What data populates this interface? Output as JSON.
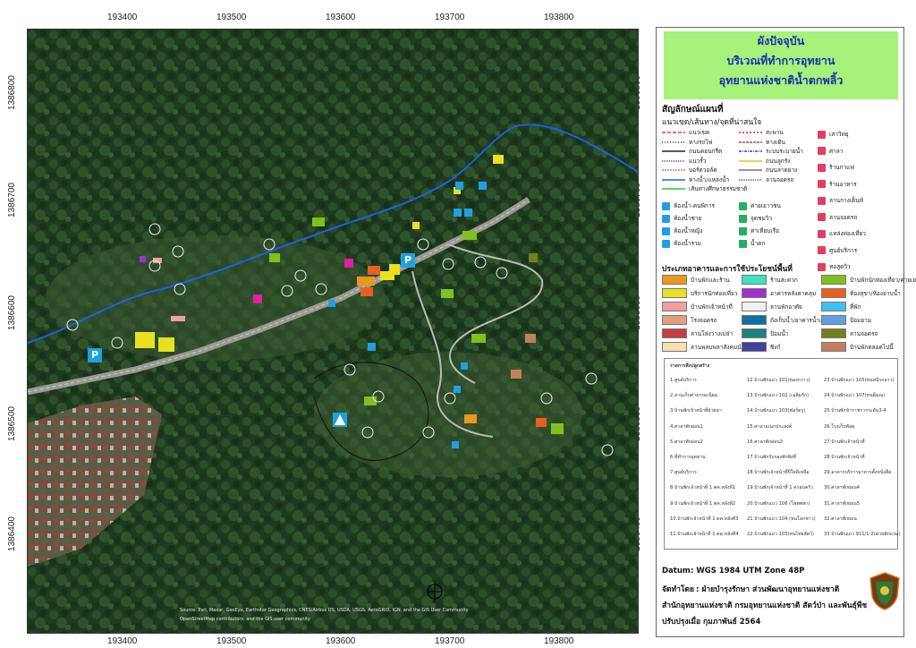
{
  "map": {
    "x_ticks": [
      "193400",
      "193500",
      "193600",
      "193700",
      "193800"
    ],
    "y_ticks": [
      "1386800",
      "1386700",
      "1386600",
      "1386500",
      "1386400"
    ],
    "parking_label": "P",
    "attribution_1": "Source: Esri, Maxar, GeoEye, Earthstar Geographics, CNES/Airbus DS, USDA, USGS, AeroGRID, IGN, and the GIS User Community",
    "attribution_2": "OpenStreetMap contributors, and the GIS user community"
  },
  "panel": {
    "title_lines": [
      "ผังปัจจุบัน",
      "บริเวณที่ทำการอุทยาน",
      "อุทยานแห่งชาติน้ำตกพลิ้ว"
    ],
    "legend_title": "สัญลักษณ์แผนที่",
    "legend_subtitle": "แนวเขต/เส้นทาง/จุดที่น่าสนใจ",
    "lines": [
      {
        "label": "แนวเขต",
        "color": "#e04040",
        "dash": "4,2"
      },
      {
        "label": "สะพาน",
        "color": "#c03030",
        "dash": "2,2"
      },
      {
        "label": "ทางรถไฟ",
        "color": "#333333",
        "dash": "1,2"
      },
      {
        "label": "ทางเดิน",
        "color": "#c04040",
        "dash": "3,1"
      },
      {
        "label": "ถนนคอนกรีต",
        "color": "#222222",
        "dash": ""
      },
      {
        "label": "ระบบระบายน้ำ",
        "color": "#3040c0",
        "dash": "3,1,1,1"
      },
      {
        "label": "แนวรั้ว",
        "color": "#555555",
        "dash": "1,1"
      },
      {
        "label": "ถนนลูกรัง",
        "color": "#e8c020",
        "dash": ""
      },
      {
        "label": "บอร์ดวอล์ค",
        "color": "#c08060",
        "dash": "2,1"
      },
      {
        "label": "ถนนลาดยาง",
        "color": "#777777",
        "dash": ""
      },
      {
        "label": "ทางน้ำ/แหล่งน้ำ",
        "color": "#2060e0",
        "dash": ""
      },
      {
        "label": "ลานจอดรถ",
        "color": "#555555",
        "dash": "1,1"
      },
      {
        "label": "เส้นทางศึกษาธรรมชาติ",
        "color": "#30c030",
        "dash": ""
      }
    ],
    "poi_col1": [
      "ห้องน้ำ-คนพิการ",
      "ห้องน้ำชาย",
      "ห้องน้ำหญิง",
      "ห้องน้ำรวม"
    ],
    "poi_col2": [
      "ค่ายเยาวชน",
      "จุดชมวิว",
      "ท่าเทียบเรือ",
      "น้ำตก"
    ],
    "poi_col3": [
      "เสาวิทยุ",
      "ศาลา",
      "ร้านกาแฟ",
      "ร้านอาหาร",
      "ลานกางเต็นท์",
      "ลานจอดรถ",
      "แหล่งท่องเที่ยว",
      "ศูนย์บริการ",
      "หอสูดวิว"
    ],
    "building_title": "ประเภทอาคารและการใช้ประโยชน์พื้นที่",
    "building_types": [
      {
        "label": "บ้านพักและร้าน",
        "color": "#e89820"
      },
      {
        "label": "ร้านสะดวก",
        "color": "#40e0c0"
      },
      {
        "label": "บ้านพักนักท่องเที่ยว/ค่ายเยาวชน",
        "color": "#80c020"
      },
      {
        "label": "บริการนักท่องเที่ยว",
        "color": "#e8e020"
      },
      {
        "label": "อาคารหลังคาคลุม",
        "color": "#a030d0"
      },
      {
        "label": "ห้องสุขา/ห้องอาบน้ำ",
        "color": "#e86020"
      },
      {
        "label": "บ้านพักเจ้าหน้าที่",
        "color": "#f0a0a0"
      },
      {
        "label": "ลานพักอาศัย",
        "color": "#f0f0f0"
      },
      {
        "label": "ที่พัก",
        "color": "#40c0f0"
      },
      {
        "label": "โรงจอดรถ",
        "color": "#e0a080"
      },
      {
        "label": "ถังเก็บน้ำ/อาคารน้ำเย็น",
        "color": "#1070a0"
      },
      {
        "label": "ป้อมยาม",
        "color": "#60a0e0"
      },
      {
        "label": "ลานโล่งว่างเปล่า",
        "color": "#c04040"
      },
      {
        "label": "ป้อมน้ำ",
        "color": "#208080"
      },
      {
        "label": "ลานจอดรถ",
        "color": "#708020"
      },
      {
        "label": "ลานพลบพลาสังคมนำชี้",
        "color": "#f8e0b0"
      },
      {
        "label": "ซิงก์",
        "color": "#4040a0"
      },
      {
        "label": "บ้านพักตลอดไปนี้",
        "color": "#c08060"
      }
    ],
    "ref_title": "รายการสิ่งปลูกสร้าง",
    "ref_col1": [
      "1.ศูนย์บริการ",
      "2.ลานเก็บค่าธรรมเนียม",
      "3.บ้านพักเจ้าหน้าที่ฝ่ายนา",
      "4.ศาลาพักผ่อน1",
      "5.ศาลาพักผ่อน2",
      "6.ที่ทำการอุทยาน",
      "7.ศูนย์บริการ",
      "8.บ้านพักเจ้าหน้าที่ 1 ตค.หลังที1",
      "9.บ้านพักเจ้าหน้าที่ 1 ตค.หลังที2",
      "10.บ้านพักเจ้าหน้าที่ 1 ตค.หลังที3",
      "11.บ้านพักเจ้าหน้าที่ 1 ตค.หลังที4"
    ],
    "ref_col2": [
      "12.บ้านพักแถว 101(ทองกวาว)",
      "13.บ้านพักแถว 102 (เฉลิมรัก)",
      "14.บ้านพักแถว 103(ฟอร์ตรู)",
      "15.ศาลาอเนกประสงค์",
      "16.ศาลาพักผ่อน3",
      "17.บ้านพักรับรองพักพิงที่",
      "18.บ้านพักเจ้าหน้าที่ปีใจดีเหลือ",
      "19.บ้านพักเจ้าหน้าที่ 1 ครอบครัว",
      "20.บ้านพักแถว 106 (โพพพพา)",
      "21.บ้านพักแถว 104 (ทนโลกชาว)",
      "22.บ้านพักแถว 105(ทนไทยสัตว์)"
    ],
    "ref_col3": [
      "23.บ้านพักแถว 105(ทนหนีรกลาว)",
      "24.บ้านพักแถว 107(ทนฉีมณ)",
      "25.บ้านพักข้าราชการระดับ3-4",
      "26.โรงเก็บพัสดุ",
      "27.บ้านพักเจ้าหน้าที่",
      "28.บ้านพักเจ้าหน้าที่",
      "29.อาคารบริการอาหารตั้งหนังสือ",
      "30.ศาลาพักผ่อน4",
      "31.ศาลาพักผ่อน5",
      "32.ศาลาพักผ่อน",
      "33.บ้านพักแถว 911/1-2(ค่ายพักแรม)"
    ],
    "datum_label": "Datum",
    "datum_value": ": WGS 1984 UTM Zone 48P",
    "made_by_label": "จัดทำโดย",
    "made_by_value": ": ฝ่ายบำรุงรักษา ส่วนพัฒนาอุทยานแห่งชาติ",
    "org": "สำนักอุทยานแห่งชาติ กรมอุทยานแห่งชาติ สัตว์ป่า และพันธุ์พืช",
    "updated": "ปรับปรุงเมื่อ กุมภาพันธ์ 2564"
  },
  "colors": {
    "title_bg": "#a6f27a",
    "title_text": "#1a2fb0",
    "river": "#1f5fe0",
    "forest_dark": "#1e3a1e"
  }
}
